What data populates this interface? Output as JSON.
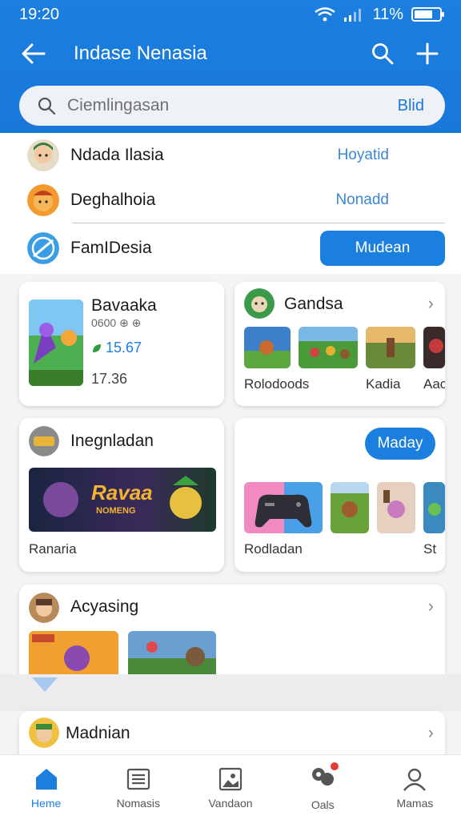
{
  "status_bar": {
    "time": "19:20",
    "battery": "11%"
  },
  "header": {
    "title": "Indase Nenasia"
  },
  "search": {
    "placeholder": "Ciemlingasan",
    "action_label": "Blid"
  },
  "friends": [
    {
      "name": "Ndada Ilasia",
      "status": "Hoyatid",
      "avatar_color": "#d9c9a8"
    },
    {
      "name": "Deghalhoia",
      "status": "Nonadd",
      "avatar_color": "#f29a2e"
    },
    {
      "name": "FamIDesia",
      "button": "Mudean",
      "avatar_color": "#3a9ee4"
    }
  ],
  "cards": {
    "game1": {
      "title": "Bavaaka",
      "meta": "0600 ⊕ ⊕",
      "score": "15.67",
      "price": "17.36"
    },
    "game2": {
      "title": "Gandsa",
      "captions": [
        "Rolodoods",
        "Kadia",
        "Aac"
      ]
    },
    "game3": {
      "title": "Inegnladan",
      "banner_text": "Ravaa",
      "banner_sub": "NOMENG",
      "caption": "Ranaria"
    },
    "game4": {
      "button": "Maday",
      "captions": [
        "Rodladan",
        "St"
      ]
    },
    "game5": {
      "title": "Acyasing"
    },
    "game6": {
      "title": "Madnian"
    }
  },
  "nav": [
    {
      "label": "Heme",
      "icon": "home-icon",
      "active": true
    },
    {
      "label": "Nomasis",
      "icon": "news-icon"
    },
    {
      "label": "Vandaon",
      "icon": "gallery-icon"
    },
    {
      "label": "Oals",
      "icon": "community-icon"
    },
    {
      "label": "Mamas",
      "icon": "profile-icon"
    }
  ],
  "colors": {
    "primary": "#1b7fe0",
    "link": "#3a87d6",
    "badge": "#e53935"
  }
}
